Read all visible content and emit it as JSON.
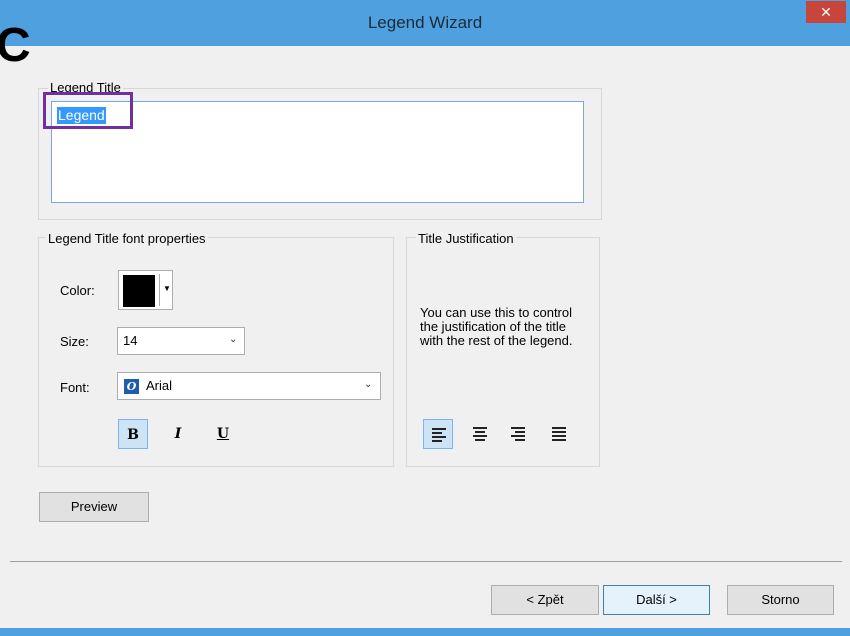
{
  "window": {
    "title": "Legend Wizard",
    "close_glyph": "✕",
    "partial_glyph": "C",
    "accent_color": "#4ea1de"
  },
  "legend_title_group": {
    "label": "Legend Title",
    "value": "Legend"
  },
  "font_group": {
    "label": "Legend Title font properties",
    "color_label": "Color:",
    "color_value": "#000000",
    "size_label": "Size:",
    "size_value": "14",
    "font_label": "Font:",
    "font_value": "Arial",
    "bold_glyph": "B",
    "italic_glyph": "I",
    "underline_glyph": "U",
    "bold_active": true
  },
  "justification_group": {
    "label": "Title Justification",
    "description": "You can use this to control the justification of the title with the rest of the legend.",
    "options": [
      "left",
      "center",
      "right",
      "justify"
    ],
    "selected": "left"
  },
  "buttons": {
    "preview": "Preview",
    "back": "< Zpět",
    "next": "Další >",
    "cancel": "Storno"
  }
}
